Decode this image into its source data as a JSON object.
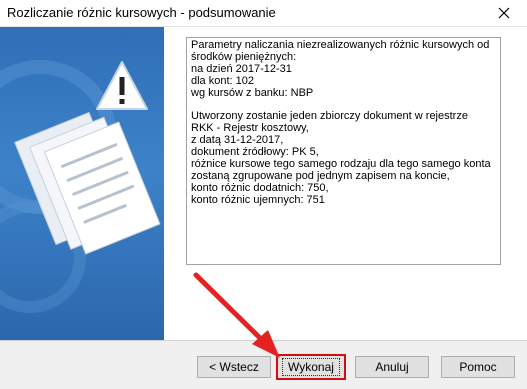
{
  "window": {
    "title": "Rozliczanie różnic kursowych - podsumowanie",
    "close_icon": "close-icon"
  },
  "summary": {
    "lines": [
      "Parametry naliczania niezrealizowanych różnic kursowych od",
      "środków pieniężnych:",
      "na dzień 2017-12-31",
      "dla kont: 102",
      "wg kursów z banku: NBP",
      "",
      "Utworzony zostanie jeden zbiorczy dokument w rejestrze",
      "RKK - Rejestr kosztowy,",
      "z datą 31-12-2017,",
      "dokument źródłowy: PK 5,",
      "różnice kursowe tego samego rodzaju dla tego samego konta",
      "zostaną zgrupowane pod jednym zapisem na koncie,",
      "konto różnic dodatnich: 750,",
      "konto różnic ujemnych: 751"
    ]
  },
  "buttons": {
    "back": "< Wstecz",
    "execute": "Wykonaj",
    "cancel": "Anuluj",
    "help": "Pomoc"
  },
  "colors": {
    "highlight": "#cc1111",
    "side_panel": "#3d82c8"
  }
}
